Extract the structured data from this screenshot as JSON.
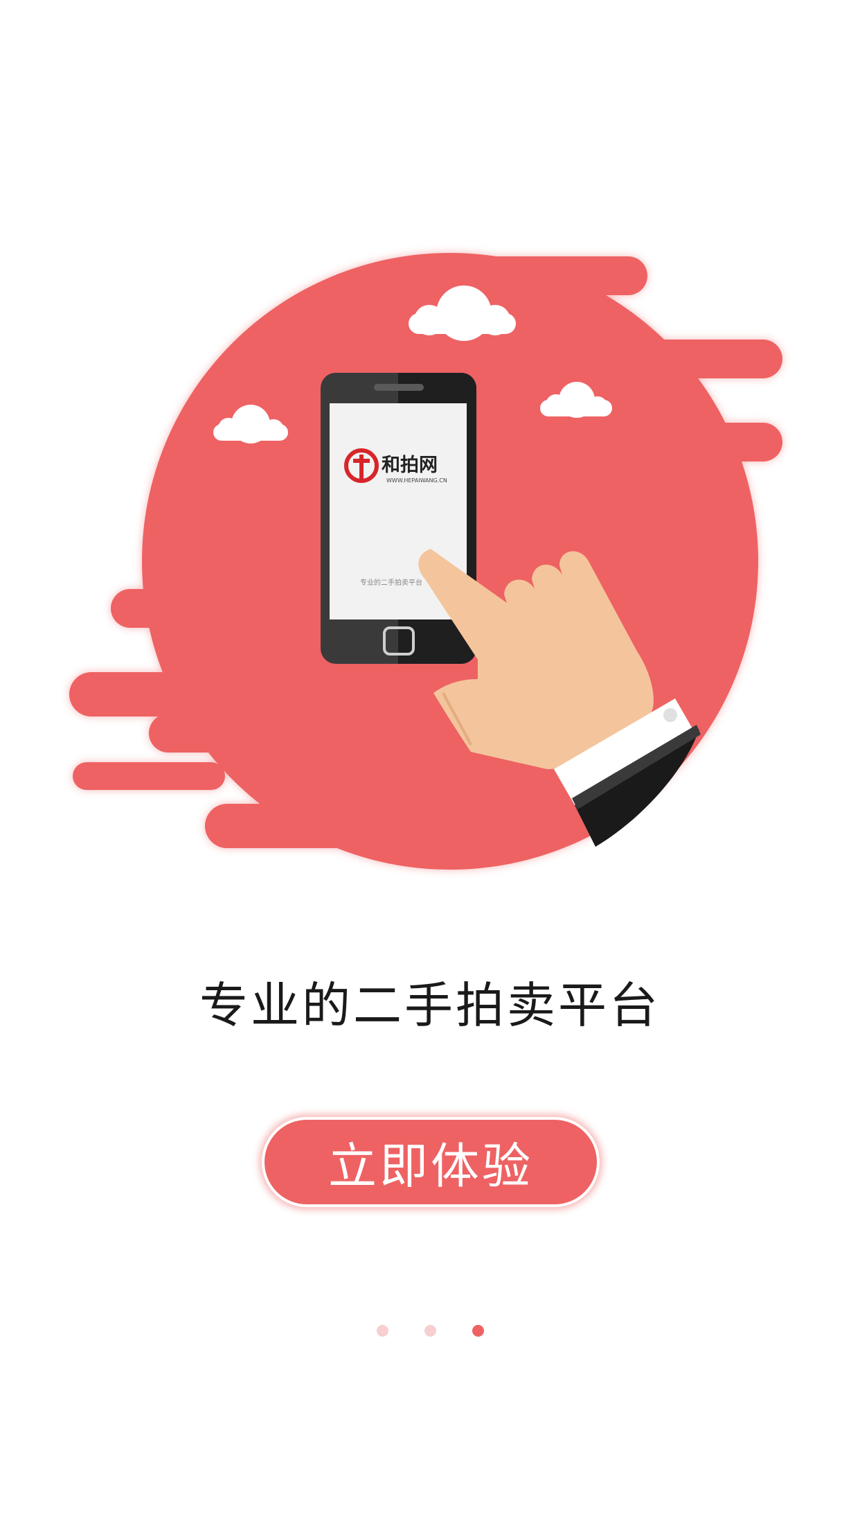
{
  "app": {
    "brand_name": "和拍网",
    "brand_url": "WWW.HEPAIWANG.CN",
    "phone_screen_caption": "专业的二手拍卖平台"
  },
  "onboarding": {
    "tagline": "专业的二手拍卖平台",
    "cta_label": "立即体验",
    "page_count": 3,
    "active_page": 3
  },
  "colors": {
    "accent": "#ee6263",
    "dot_inactive": "#f8cfd0",
    "skin": "#f4c59c",
    "phone_body": "#2b2b2b",
    "phone_screen": "#f2f2f2",
    "text": "#1a1a1a"
  },
  "icons": [
    "cloud-icon",
    "smartphone-icon",
    "hand-icon",
    "brand-logo-icon"
  ]
}
